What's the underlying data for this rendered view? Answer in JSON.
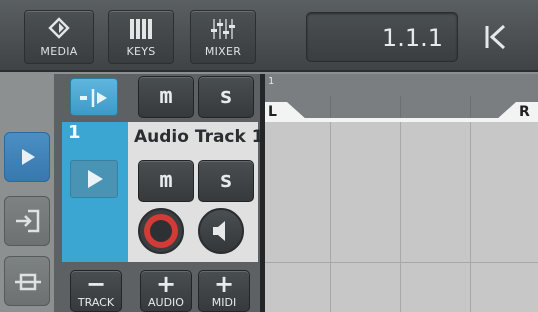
{
  "toolbar": {
    "media_label": "MEDIA",
    "keys_label": "KEYS",
    "mixer_label": "MIXER",
    "position": "1.1.1"
  },
  "track": {
    "number": "1",
    "name": "Audio Track 1",
    "mute_glyph": "m",
    "solo_glyph": "s",
    "color": "#3aa6d1"
  },
  "global": {
    "mute_glyph": "m",
    "solo_glyph": "s"
  },
  "bottom": {
    "track_label": "TRACK",
    "track_symbol": "−",
    "audio_label": "AUDIO",
    "audio_symbol": "+",
    "midi_label": "MIDI",
    "midi_symbol": "+"
  },
  "ruler": {
    "bar_number": "1",
    "left_locator": "L",
    "right_locator": "R"
  }
}
